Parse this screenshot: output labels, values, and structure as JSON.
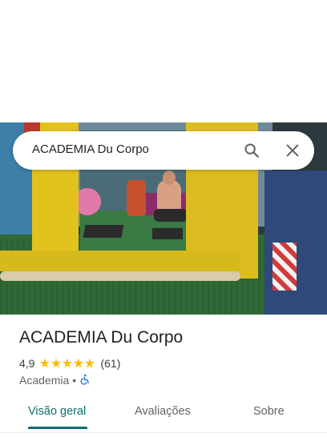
{
  "search": {
    "query": "ACADEMIA Du Corpo",
    "search_icon": "search-icon",
    "close_icon": "close-icon"
  },
  "place": {
    "name": "ACADEMIA Du Corpo",
    "rating": "4,9",
    "rating_stars": 5,
    "review_count": "(61)",
    "category": "Academia",
    "separator": "•",
    "accessibility_icon": "wheelchair-icon"
  },
  "tabs": [
    {
      "label": "Visão geral",
      "active": true
    },
    {
      "label": "Avaliações",
      "active": false
    },
    {
      "label": "Sobre",
      "active": false
    }
  ],
  "colors": {
    "accent": "#0b6e6e",
    "star": "#fbbc04",
    "accessibility": "#1a73e8"
  }
}
